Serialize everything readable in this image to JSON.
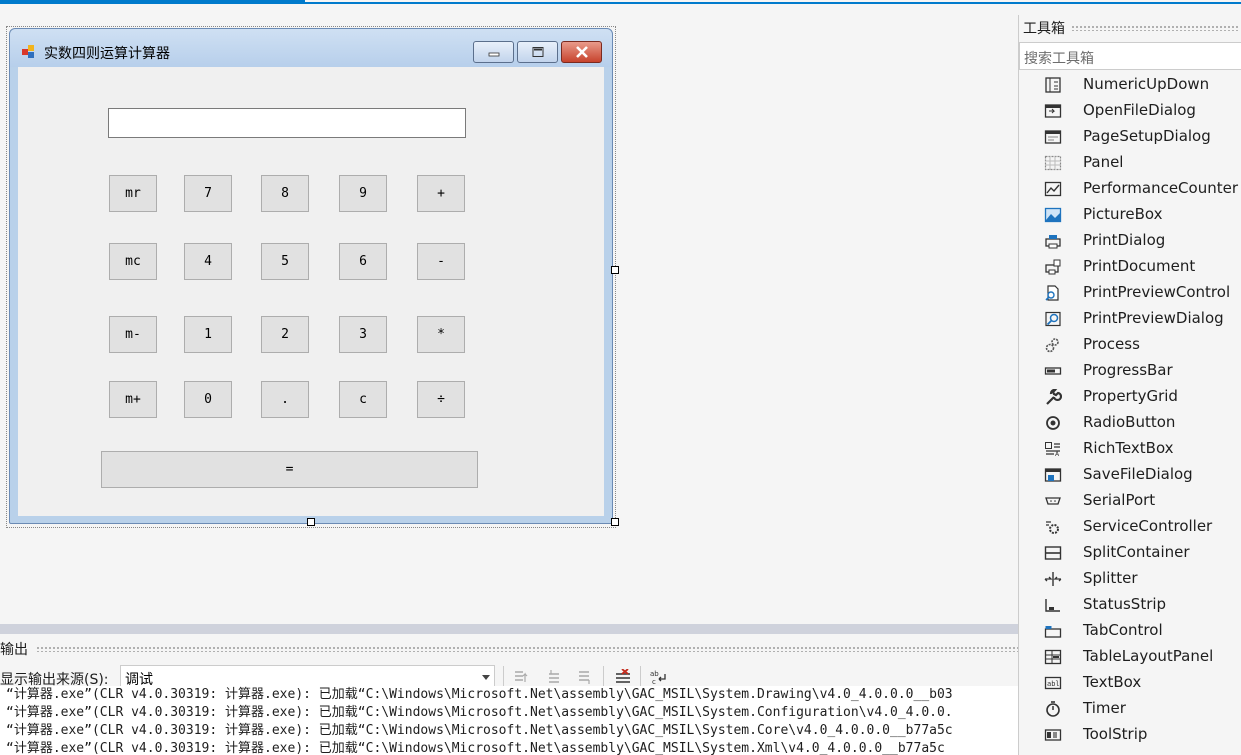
{
  "form": {
    "title": "实数四则运算计算器",
    "display_value": "",
    "buttons": [
      {
        "label": "mr",
        "name": "mr-button"
      },
      {
        "label": "7",
        "name": "digit-7-button"
      },
      {
        "label": "8",
        "name": "digit-8-button"
      },
      {
        "label": "9",
        "name": "digit-9-button"
      },
      {
        "label": "+",
        "name": "plus-button"
      },
      {
        "label": "mc",
        "name": "mc-button"
      },
      {
        "label": "4",
        "name": "digit-4-button"
      },
      {
        "label": "5",
        "name": "digit-5-button"
      },
      {
        "label": "6",
        "name": "digit-6-button"
      },
      {
        "label": "-",
        "name": "minus-button"
      },
      {
        "label": "m-",
        "name": "m-minus-button"
      },
      {
        "label": "1",
        "name": "digit-1-button"
      },
      {
        "label": "2",
        "name": "digit-2-button"
      },
      {
        "label": "3",
        "name": "digit-3-button"
      },
      {
        "label": "*",
        "name": "multiply-button"
      },
      {
        "label": "m+",
        "name": "m-plus-button"
      },
      {
        "label": "0",
        "name": "digit-0-button"
      },
      {
        "label": ".",
        "name": "decimal-button"
      },
      {
        "label": "c",
        "name": "clear-button"
      },
      {
        "label": "÷",
        "name": "divide-button"
      }
    ],
    "equals_label": "="
  },
  "toolbox": {
    "title": "工具箱",
    "search_placeholder": "搜索工具箱",
    "items": [
      {
        "label": "NumericUpDown",
        "icon": "numeric-updown-icon"
      },
      {
        "label": "OpenFileDialog",
        "icon": "open-file-dialog-icon"
      },
      {
        "label": "PageSetupDialog",
        "icon": "page-setup-dialog-icon"
      },
      {
        "label": "Panel",
        "icon": "panel-icon"
      },
      {
        "label": "PerformanceCounter",
        "icon": "performance-counter-icon"
      },
      {
        "label": "PictureBox",
        "icon": "picture-box-icon"
      },
      {
        "label": "PrintDialog",
        "icon": "print-dialog-icon"
      },
      {
        "label": "PrintDocument",
        "icon": "print-document-icon"
      },
      {
        "label": "PrintPreviewControl",
        "icon": "print-preview-control-icon"
      },
      {
        "label": "PrintPreviewDialog",
        "icon": "print-preview-dialog-icon"
      },
      {
        "label": "Process",
        "icon": "process-icon"
      },
      {
        "label": "ProgressBar",
        "icon": "progress-bar-icon"
      },
      {
        "label": "PropertyGrid",
        "icon": "property-grid-icon"
      },
      {
        "label": "RadioButton",
        "icon": "radio-button-icon"
      },
      {
        "label": "RichTextBox",
        "icon": "rich-text-box-icon"
      },
      {
        "label": "SaveFileDialog",
        "icon": "save-file-dialog-icon"
      },
      {
        "label": "SerialPort",
        "icon": "serial-port-icon"
      },
      {
        "label": "ServiceController",
        "icon": "service-controller-icon"
      },
      {
        "label": "SplitContainer",
        "icon": "split-container-icon"
      },
      {
        "label": "Splitter",
        "icon": "splitter-icon"
      },
      {
        "label": "StatusStrip",
        "icon": "status-strip-icon"
      },
      {
        "label": "TabControl",
        "icon": "tab-control-icon"
      },
      {
        "label": "TableLayoutPanel",
        "icon": "table-layout-panel-icon"
      },
      {
        "label": "TextBox",
        "icon": "text-box-icon"
      },
      {
        "label": "Timer",
        "icon": "timer-icon"
      },
      {
        "label": "ToolStrip",
        "icon": "tool-strip-icon"
      }
    ]
  },
  "output": {
    "title": "输出",
    "source_label": "显示输出来源(S):",
    "source_value": "调试",
    "lines": [
      "“计算器.exe”(CLR v4.0.30319: 计算器.exe): 已加载“C:\\Windows\\Microsoft.Net\\assembly\\GAC_MSIL\\System.Drawing\\v4.0_4.0.0.0__b03",
      "“计算器.exe”(CLR v4.0.30319: 计算器.exe): 已加载“C:\\Windows\\Microsoft.Net\\assembly\\GAC_MSIL\\System.Configuration\\v4.0_4.0.0.",
      "“计算器.exe”(CLR v4.0.30319: 计算器.exe): 已加载“C:\\Windows\\Microsoft.Net\\assembly\\GAC_MSIL\\System.Core\\v4.0_4.0.0.0__b77a5c",
      "“计算器.exe”(CLR v4.0.30319: 计算器.exe): 已加载“C:\\Windows\\Microsoft.Net\\assembly\\GAC_MSIL\\System.Xml\\v4.0_4.0.0.0__b77a5c"
    ]
  },
  "colors": {
    "accent": "#007acc",
    "form_frame": "#b9d1ea",
    "button_face": "#e1e1e1",
    "close_button": "#c7432d"
  }
}
